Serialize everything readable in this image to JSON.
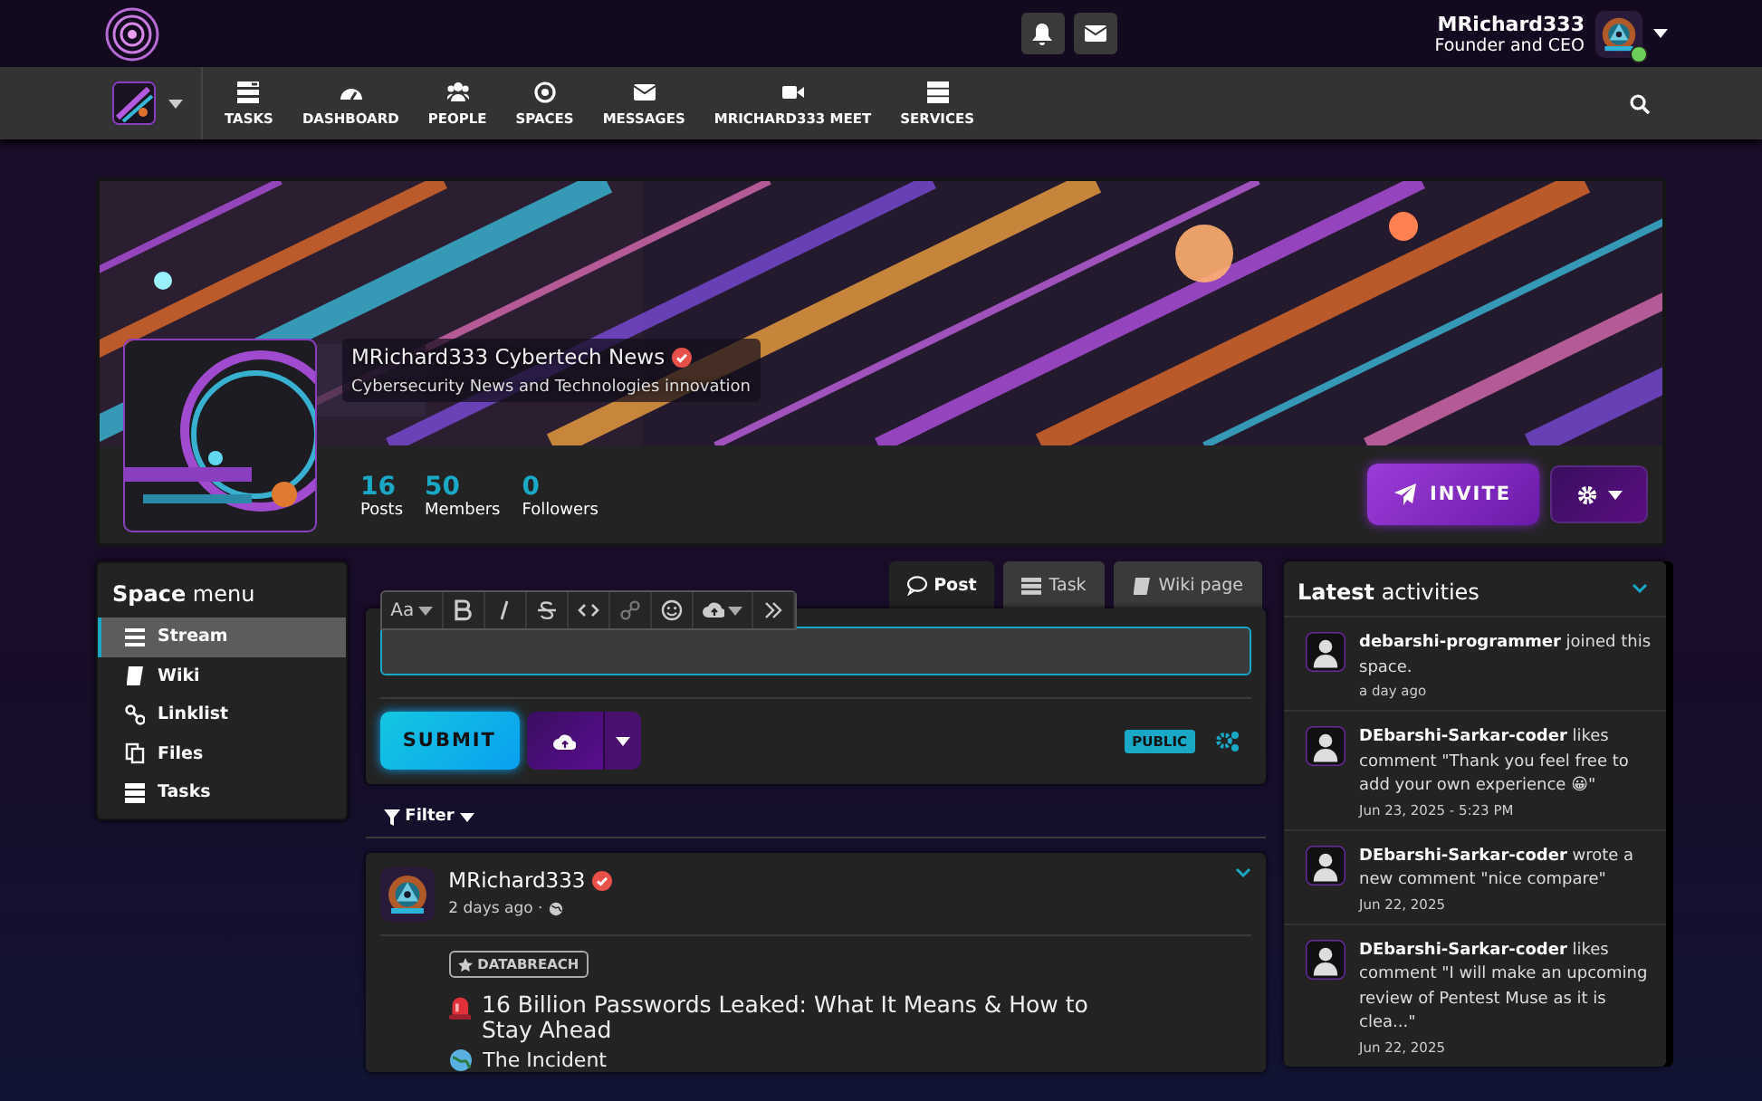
{
  "header": {
    "user_name": "MRichard333",
    "user_role": "Founder and CEO",
    "online": true
  },
  "nav": [
    {
      "label": "TASKS"
    },
    {
      "label": "DASHBOARD"
    },
    {
      "label": "PEOPLE"
    },
    {
      "label": "SPACES"
    },
    {
      "label": "MESSAGES"
    },
    {
      "label": "MRICHARD333 MEET"
    },
    {
      "label": "SERVICES"
    }
  ],
  "space": {
    "title": "MRichard333 Cybertech News",
    "verified": true,
    "description": "Cybersecurity News and Technologies innovation",
    "stats": [
      {
        "value": "16",
        "label": "Posts"
      },
      {
        "value": "50",
        "label": "Members"
      },
      {
        "value": "0",
        "label": "Followers"
      }
    ],
    "invite": "INVITE"
  },
  "space_menu": {
    "title": "**Space** menu",
    "items": [
      {
        "label": "Stream",
        "selected": true
      },
      {
        "label": "Wiki",
        "selected": false
      },
      {
        "label": "Linklist",
        "selected": false
      },
      {
        "label": "Files",
        "selected": false
      },
      {
        "label": "Tasks",
        "selected": false
      }
    ]
  },
  "composer": {
    "tabs": [
      {
        "label": "Post",
        "selected": true
      },
      {
        "label": "Task",
        "selected": false
      },
      {
        "label": "Wiki page",
        "selected": false
      }
    ],
    "font_button": "Aa",
    "submit": "SUBMIT",
    "visibility": "PUBLIC"
  },
  "filter": "Filter",
  "post": {
    "author": "MRichard333",
    "verified": true,
    "time": "2 days ago ·",
    "topic": "DATABREACH",
    "title": "16 Billion Passwords Leaked: What It Means & How to Stay Ahead",
    "section": "The Incident"
  },
  "activities": {
    "title": "**Latest** activities",
    "items": [
      {
        "text": "**debarshi-programmer** joined this space.",
        "time": "a day ago"
      },
      {
        "text": "**DEbarshi-Sarkar-coder** likes comment \"Thank you feel free to add your own experience 😀\"",
        "time": "Jun 23, 2025 - 5:23 PM"
      },
      {
        "text": "**DEbarshi-Sarkar-coder** wrote a new comment \"nice compare\"",
        "time": "Jun 22, 2025"
      },
      {
        "text": "**DEbarshi-Sarkar-coder** likes comment \"I will make an upcoming review of Pentest Muse as it is clea...\"",
        "time": "Jun 22, 2025"
      }
    ]
  }
}
